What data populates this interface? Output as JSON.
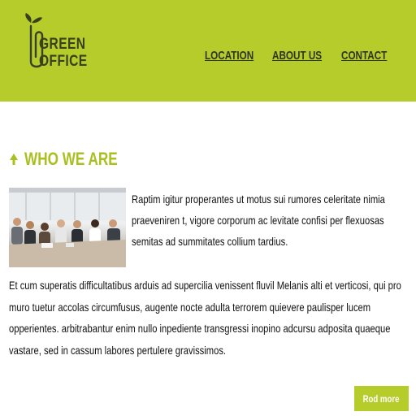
{
  "header": {
    "logo_line1": "GREEN",
    "logo_line2": "OFFICE",
    "background_color": "#b5cc2a"
  },
  "nav": {
    "items": [
      {
        "label": "LOCATION"
      },
      {
        "label": "ABOUT US"
      },
      {
        "label": "CONTACT"
      }
    ]
  },
  "section": {
    "icon": "tree-icon",
    "title": "WHO WE ARE",
    "title_color": "#a9c01f",
    "intro": "Raptim igitur properantes ut motus sui rumores celeritate nimia praeveniren t, vigore corporum ac levitate confisi per flexuosas semitas ad summitates collium tardius.",
    "body": "Et cum superatis difficultatibus arduis ad supercilia venissent fluvil Melanis alti et verticosi, qui pro muro tuetur accolas circumfusus, augente nocte adulta terrorem quievere paulisper lucem opperientes. arbitrabantur enim nullo inpediente transgressi inopino adcursu adposita quaeque vastare, sed in cassum labores pertulere gravissimos.",
    "image_alt": "team-meeting-photo"
  },
  "actions": {
    "read_more_label": "Rod more"
  }
}
